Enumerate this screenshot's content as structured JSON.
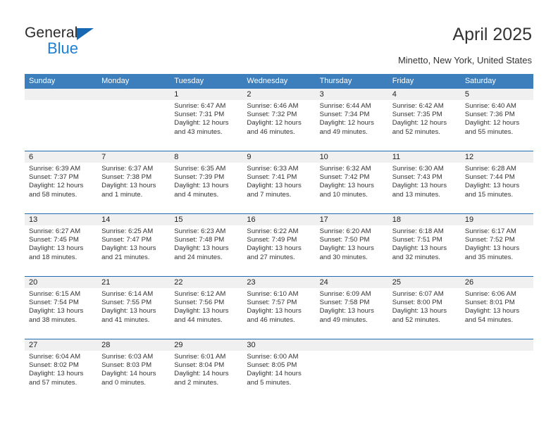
{
  "brand": {
    "name_top": "General",
    "name_bottom": "Blue",
    "triangle_color": "#1668b3",
    "blue_text_color": "#1b7fd4"
  },
  "header": {
    "title": "April 2025",
    "subtitle": "Minetto, New York, United States"
  },
  "colors": {
    "header_row_background": "#3d7ebd",
    "header_row_text": "#ffffff",
    "daynum_background": "#f0f0f0",
    "row_divider": "#1f6cb0",
    "body_text": "#333333",
    "page_background": "#ffffff"
  },
  "weekdays": [
    "Sunday",
    "Monday",
    "Tuesday",
    "Wednesday",
    "Thursday",
    "Friday",
    "Saturday"
  ],
  "labels": {
    "sunrise_prefix": "Sunrise:",
    "sunset_prefix": "Sunset:",
    "daylight_prefix": "Daylight:"
  },
  "weeks": [
    [
      {
        "day": "",
        "lines": []
      },
      {
        "day": "",
        "lines": []
      },
      {
        "day": "1",
        "lines": [
          "Sunrise: 6:47 AM",
          "Sunset: 7:31 PM",
          "Daylight: 12 hours",
          "and 43 minutes."
        ]
      },
      {
        "day": "2",
        "lines": [
          "Sunrise: 6:46 AM",
          "Sunset: 7:32 PM",
          "Daylight: 12 hours",
          "and 46 minutes."
        ]
      },
      {
        "day": "3",
        "lines": [
          "Sunrise: 6:44 AM",
          "Sunset: 7:34 PM",
          "Daylight: 12 hours",
          "and 49 minutes."
        ]
      },
      {
        "day": "4",
        "lines": [
          "Sunrise: 6:42 AM",
          "Sunset: 7:35 PM",
          "Daylight: 12 hours",
          "and 52 minutes."
        ]
      },
      {
        "day": "5",
        "lines": [
          "Sunrise: 6:40 AM",
          "Sunset: 7:36 PM",
          "Daylight: 12 hours",
          "and 55 minutes."
        ]
      }
    ],
    [
      {
        "day": "6",
        "lines": [
          "Sunrise: 6:39 AM",
          "Sunset: 7:37 PM",
          "Daylight: 12 hours",
          "and 58 minutes."
        ]
      },
      {
        "day": "7",
        "lines": [
          "Sunrise: 6:37 AM",
          "Sunset: 7:38 PM",
          "Daylight: 13 hours",
          "and 1 minute."
        ]
      },
      {
        "day": "8",
        "lines": [
          "Sunrise: 6:35 AM",
          "Sunset: 7:39 PM",
          "Daylight: 13 hours",
          "and 4 minutes."
        ]
      },
      {
        "day": "9",
        "lines": [
          "Sunrise: 6:33 AM",
          "Sunset: 7:41 PM",
          "Daylight: 13 hours",
          "and 7 minutes."
        ]
      },
      {
        "day": "10",
        "lines": [
          "Sunrise: 6:32 AM",
          "Sunset: 7:42 PM",
          "Daylight: 13 hours",
          "and 10 minutes."
        ]
      },
      {
        "day": "11",
        "lines": [
          "Sunrise: 6:30 AM",
          "Sunset: 7:43 PM",
          "Daylight: 13 hours",
          "and 13 minutes."
        ]
      },
      {
        "day": "12",
        "lines": [
          "Sunrise: 6:28 AM",
          "Sunset: 7:44 PM",
          "Daylight: 13 hours",
          "and 15 minutes."
        ]
      }
    ],
    [
      {
        "day": "13",
        "lines": [
          "Sunrise: 6:27 AM",
          "Sunset: 7:45 PM",
          "Daylight: 13 hours",
          "and 18 minutes."
        ]
      },
      {
        "day": "14",
        "lines": [
          "Sunrise: 6:25 AM",
          "Sunset: 7:47 PM",
          "Daylight: 13 hours",
          "and 21 minutes."
        ]
      },
      {
        "day": "15",
        "lines": [
          "Sunrise: 6:23 AM",
          "Sunset: 7:48 PM",
          "Daylight: 13 hours",
          "and 24 minutes."
        ]
      },
      {
        "day": "16",
        "lines": [
          "Sunrise: 6:22 AM",
          "Sunset: 7:49 PM",
          "Daylight: 13 hours",
          "and 27 minutes."
        ]
      },
      {
        "day": "17",
        "lines": [
          "Sunrise: 6:20 AM",
          "Sunset: 7:50 PM",
          "Daylight: 13 hours",
          "and 30 minutes."
        ]
      },
      {
        "day": "18",
        "lines": [
          "Sunrise: 6:18 AM",
          "Sunset: 7:51 PM",
          "Daylight: 13 hours",
          "and 32 minutes."
        ]
      },
      {
        "day": "19",
        "lines": [
          "Sunrise: 6:17 AM",
          "Sunset: 7:52 PM",
          "Daylight: 13 hours",
          "and 35 minutes."
        ]
      }
    ],
    [
      {
        "day": "20",
        "lines": [
          "Sunrise: 6:15 AM",
          "Sunset: 7:54 PM",
          "Daylight: 13 hours",
          "and 38 minutes."
        ]
      },
      {
        "day": "21",
        "lines": [
          "Sunrise: 6:14 AM",
          "Sunset: 7:55 PM",
          "Daylight: 13 hours",
          "and 41 minutes."
        ]
      },
      {
        "day": "22",
        "lines": [
          "Sunrise: 6:12 AM",
          "Sunset: 7:56 PM",
          "Daylight: 13 hours",
          "and 44 minutes."
        ]
      },
      {
        "day": "23",
        "lines": [
          "Sunrise: 6:10 AM",
          "Sunset: 7:57 PM",
          "Daylight: 13 hours",
          "and 46 minutes."
        ]
      },
      {
        "day": "24",
        "lines": [
          "Sunrise: 6:09 AM",
          "Sunset: 7:58 PM",
          "Daylight: 13 hours",
          "and 49 minutes."
        ]
      },
      {
        "day": "25",
        "lines": [
          "Sunrise: 6:07 AM",
          "Sunset: 8:00 PM",
          "Daylight: 13 hours",
          "and 52 minutes."
        ]
      },
      {
        "day": "26",
        "lines": [
          "Sunrise: 6:06 AM",
          "Sunset: 8:01 PM",
          "Daylight: 13 hours",
          "and 54 minutes."
        ]
      }
    ],
    [
      {
        "day": "27",
        "lines": [
          "Sunrise: 6:04 AM",
          "Sunset: 8:02 PM",
          "Daylight: 13 hours",
          "and 57 minutes."
        ]
      },
      {
        "day": "28",
        "lines": [
          "Sunrise: 6:03 AM",
          "Sunset: 8:03 PM",
          "Daylight: 14 hours",
          "and 0 minutes."
        ]
      },
      {
        "day": "29",
        "lines": [
          "Sunrise: 6:01 AM",
          "Sunset: 8:04 PM",
          "Daylight: 14 hours",
          "and 2 minutes."
        ]
      },
      {
        "day": "30",
        "lines": [
          "Sunrise: 6:00 AM",
          "Sunset: 8:05 PM",
          "Daylight: 14 hours",
          "and 5 minutes."
        ]
      },
      {
        "day": "",
        "lines": []
      },
      {
        "day": "",
        "lines": []
      },
      {
        "day": "",
        "lines": []
      }
    ]
  ]
}
